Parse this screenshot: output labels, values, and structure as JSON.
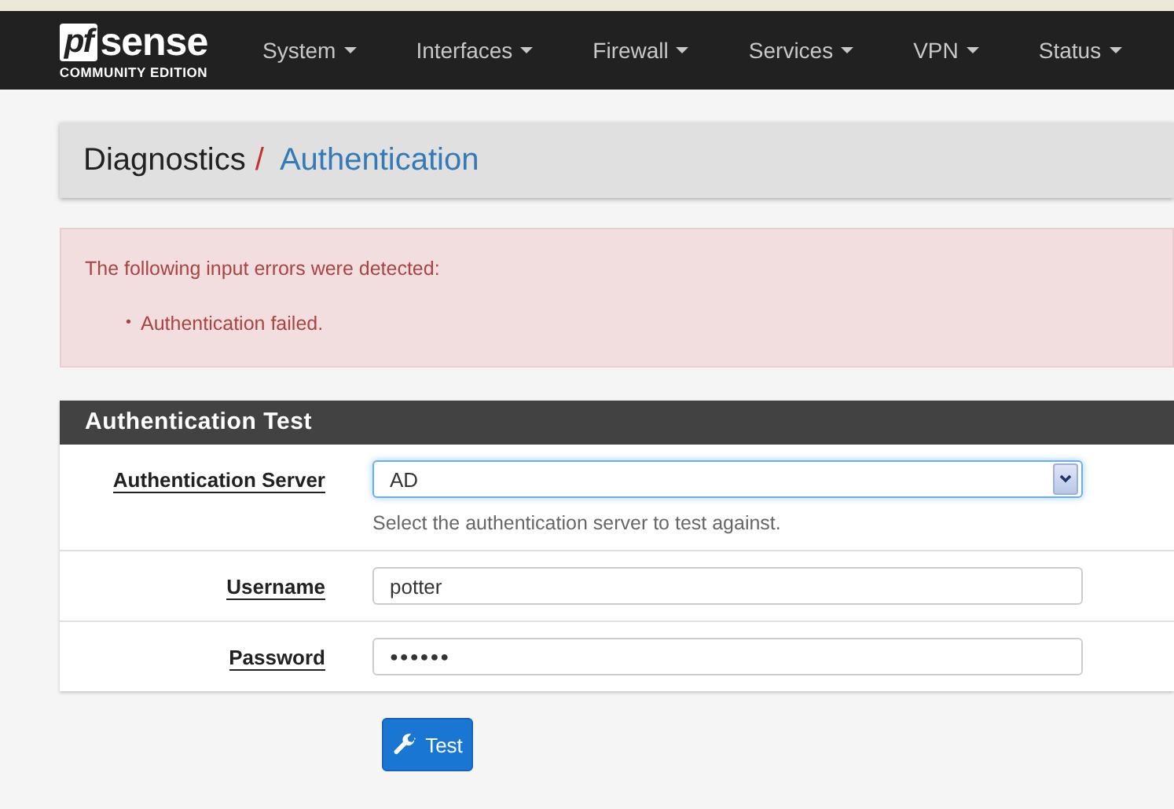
{
  "logo": {
    "mark": "pf",
    "name": "sense",
    "edition": "COMMUNITY EDITION"
  },
  "nav": [
    {
      "label": "System"
    },
    {
      "label": "Interfaces"
    },
    {
      "label": "Firewall"
    },
    {
      "label": "Services"
    },
    {
      "label": "VPN"
    },
    {
      "label": "Status"
    }
  ],
  "breadcrumb": {
    "parent": "Diagnostics",
    "separator": "/",
    "current": "Authentication"
  },
  "alert": {
    "title": "The following input errors were detected:",
    "errors": [
      {
        "bullet": "•",
        "text": "Authentication failed."
      }
    ]
  },
  "panel": {
    "title": "Authentication Test",
    "fields": [
      {
        "kind": "select",
        "label": "Authentication Server",
        "value": "AD",
        "help": "Select the authentication server to test against.",
        "focused": true
      },
      {
        "kind": "text",
        "label": "Username",
        "value": "potter",
        "focused": false
      },
      {
        "kind": "password",
        "label": "Password",
        "value": "●●●●●●",
        "focused": false
      }
    ]
  },
  "button": {
    "label": "Test"
  }
}
